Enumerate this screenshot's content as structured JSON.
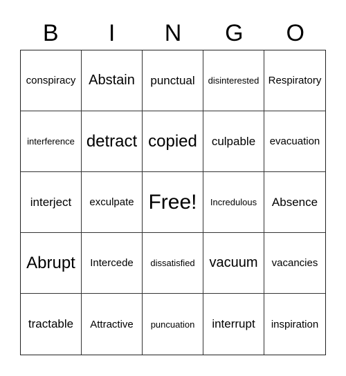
{
  "header": {
    "letters": [
      "B",
      "I",
      "N",
      "G",
      "O"
    ]
  },
  "grid": {
    "rows": [
      [
        {
          "text": "conspiracy",
          "size": "s"
        },
        {
          "text": "Abstain",
          "size": "l"
        },
        {
          "text": "punctual",
          "size": "m"
        },
        {
          "text": "disinterested",
          "size": "xs"
        },
        {
          "text": "Respiratory",
          "size": "s"
        }
      ],
      [
        {
          "text": "interference",
          "size": "xs"
        },
        {
          "text": "detract",
          "size": "xl"
        },
        {
          "text": "copied",
          "size": "xl"
        },
        {
          "text": "culpable",
          "size": "m"
        },
        {
          "text": "evacuation",
          "size": "s"
        }
      ],
      [
        {
          "text": "interject",
          "size": "m"
        },
        {
          "text": "exculpate",
          "size": "s"
        },
        {
          "text": "Free!",
          "size": "xxl"
        },
        {
          "text": "Incredulous",
          "size": "xs"
        },
        {
          "text": "Absence",
          "size": "m"
        }
      ],
      [
        {
          "text": "Abrupt",
          "size": "xl"
        },
        {
          "text": "Intercede",
          "size": "s"
        },
        {
          "text": "dissatisfied",
          "size": "xs"
        },
        {
          "text": "vacuum",
          "size": "l"
        },
        {
          "text": "vacancies",
          "size": "s"
        }
      ],
      [
        {
          "text": "tractable",
          "size": "m"
        },
        {
          "text": "Attractive",
          "size": "s"
        },
        {
          "text": "puncuation",
          "size": "xs"
        },
        {
          "text": "interrupt",
          "size": "m"
        },
        {
          "text": "inspiration",
          "size": "s"
        }
      ]
    ]
  }
}
